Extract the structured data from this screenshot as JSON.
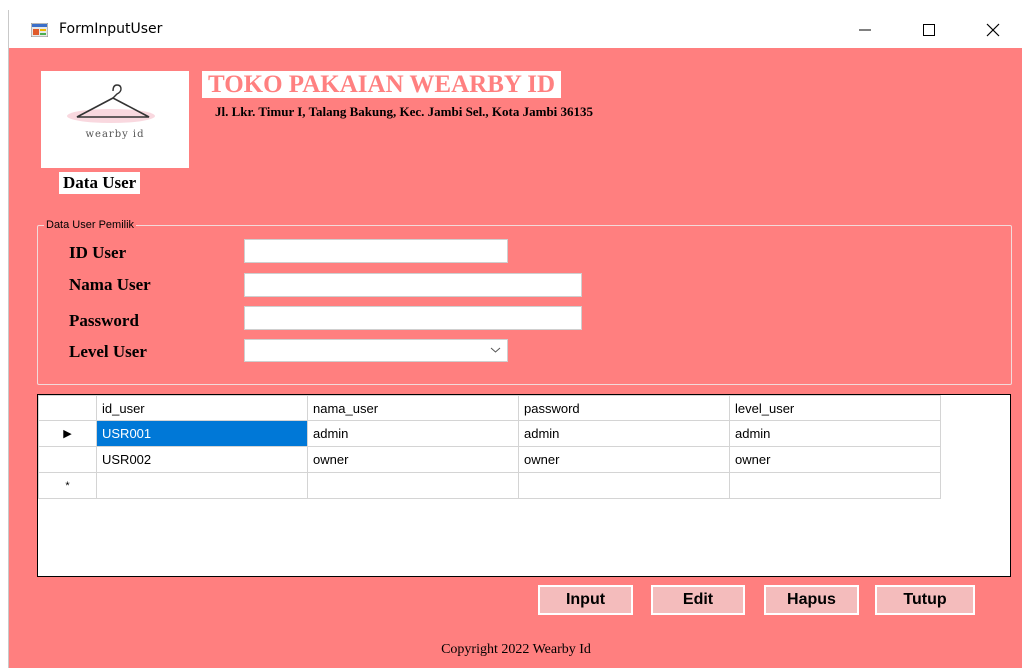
{
  "window": {
    "title": "FormInputUser",
    "app_icon": "form-icon",
    "controls": [
      "minimize-icon",
      "maximize-icon",
      "close-icon"
    ]
  },
  "header": {
    "logo_text": "wearby id",
    "section_label": "Data User",
    "shop_name": "TOKO PAKAIAN WEARBY ID",
    "address": "Jl. Lkr. Timur I, Talang Bakung, Kec. Jambi Sel., Kota Jambi 36135"
  },
  "form": {
    "group_title": "Data User Pemilik",
    "fields": {
      "id_user": {
        "label": "ID User",
        "value": ""
      },
      "nama_user": {
        "label": "Nama User",
        "value": ""
      },
      "password": {
        "label": "Password",
        "value": ""
      },
      "level_user": {
        "label": "Level User",
        "value": ""
      }
    }
  },
  "grid": {
    "columns": [
      "id_user",
      "nama_user",
      "password",
      "level_user"
    ],
    "rows": [
      [
        "USR001",
        "admin",
        "admin",
        "admin"
      ],
      [
        "USR002",
        "owner",
        "owner",
        "owner"
      ]
    ],
    "selected_indicator": "▶",
    "new_row_indicator": "*"
  },
  "buttons": {
    "input": "Input",
    "edit": "Edit",
    "hapus": "Hapus",
    "tutup": "Tutup"
  },
  "footer": {
    "copyright": "Copyright 2022 Wearby Id"
  },
  "colors": {
    "form_background": "#ff7f7f",
    "shop_name": "#ff8080",
    "selection": "#0078d7",
    "button": "#f4bcbc"
  }
}
